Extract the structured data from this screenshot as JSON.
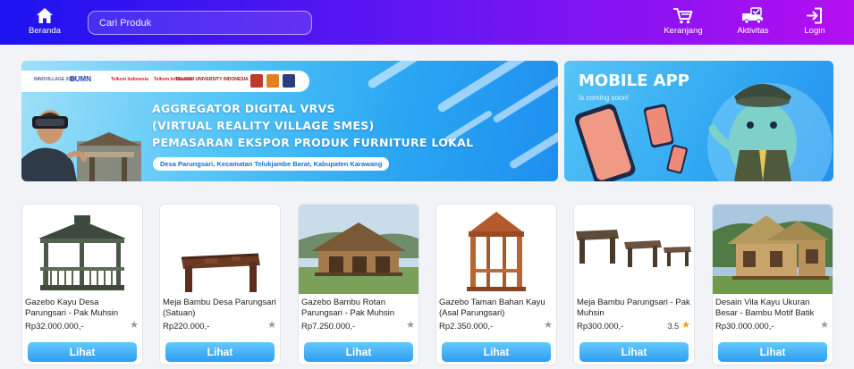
{
  "nav": {
    "home_label": "Beranda",
    "search_placeholder": "Cari Produk",
    "cart_label": "Keranjang",
    "activity_label": "Aktivitas",
    "login_label": "Login"
  },
  "banner_main": {
    "logos": [
      "INNOVILLAGE 2023",
      "BUMN",
      "Telkom Indonesia",
      "Telkom Indonesia",
      "TELKOM UNIVERSITY INDONESIA"
    ],
    "title_lines": [
      "AGGREGATOR DIGITAL VRVS",
      "(VIRTUAL REALITY VILLAGE SMES)",
      "PEMASARAN EKSPOR PRODUK FURNITURE LOKAL"
    ],
    "location": "Desa Parungsari, Kecamatan Telukjambe Barat, Kabupaten Karawang"
  },
  "banner_mobile": {
    "title": "MOBILE APP",
    "subtitle": "Is coming soon!"
  },
  "products": [
    {
      "name": "Gazebo Kayu Desa Parungsari - Pak Muhsin",
      "price": "Rp32.000.000,-",
      "rating": "",
      "star": "gray",
      "button": "Lihat"
    },
    {
      "name": "Meja Bambu Desa Parungsari (Satuan)",
      "price": "Rp220.000,-",
      "rating": "",
      "star": "gray",
      "button": "Lihat"
    },
    {
      "name": "Gazebo Bambu Rotan Parungsari - Pak Muhsin",
      "price": "Rp7.250.000,-",
      "rating": "",
      "star": "gray",
      "button": "Lihat"
    },
    {
      "name": "Gazebo Taman Bahan Kayu (Asal Parungsari)",
      "price": "Rp2.350.000,-",
      "rating": "",
      "star": "gray",
      "button": "Lihat"
    },
    {
      "name": "Meja Bambu Parungsari - Pak Muhsin",
      "price": "Rp300.000,-",
      "rating": "3.5",
      "star": "gold",
      "button": "Lihat"
    },
    {
      "name": "Desain Vila Kayu Ukuran Besar - Bambu Motif Batik",
      "price": "Rp30.000.000,-",
      "rating": "",
      "star": "gray",
      "button": "Lihat"
    }
  ],
  "colors": {
    "nav_gradient": [
      "#1d14f0",
      "#6a16f2",
      "#b40ff0"
    ],
    "button": "#2c9ef3",
    "star_gold": "#f5a40a",
    "star_gray": "#9a9a9a"
  }
}
